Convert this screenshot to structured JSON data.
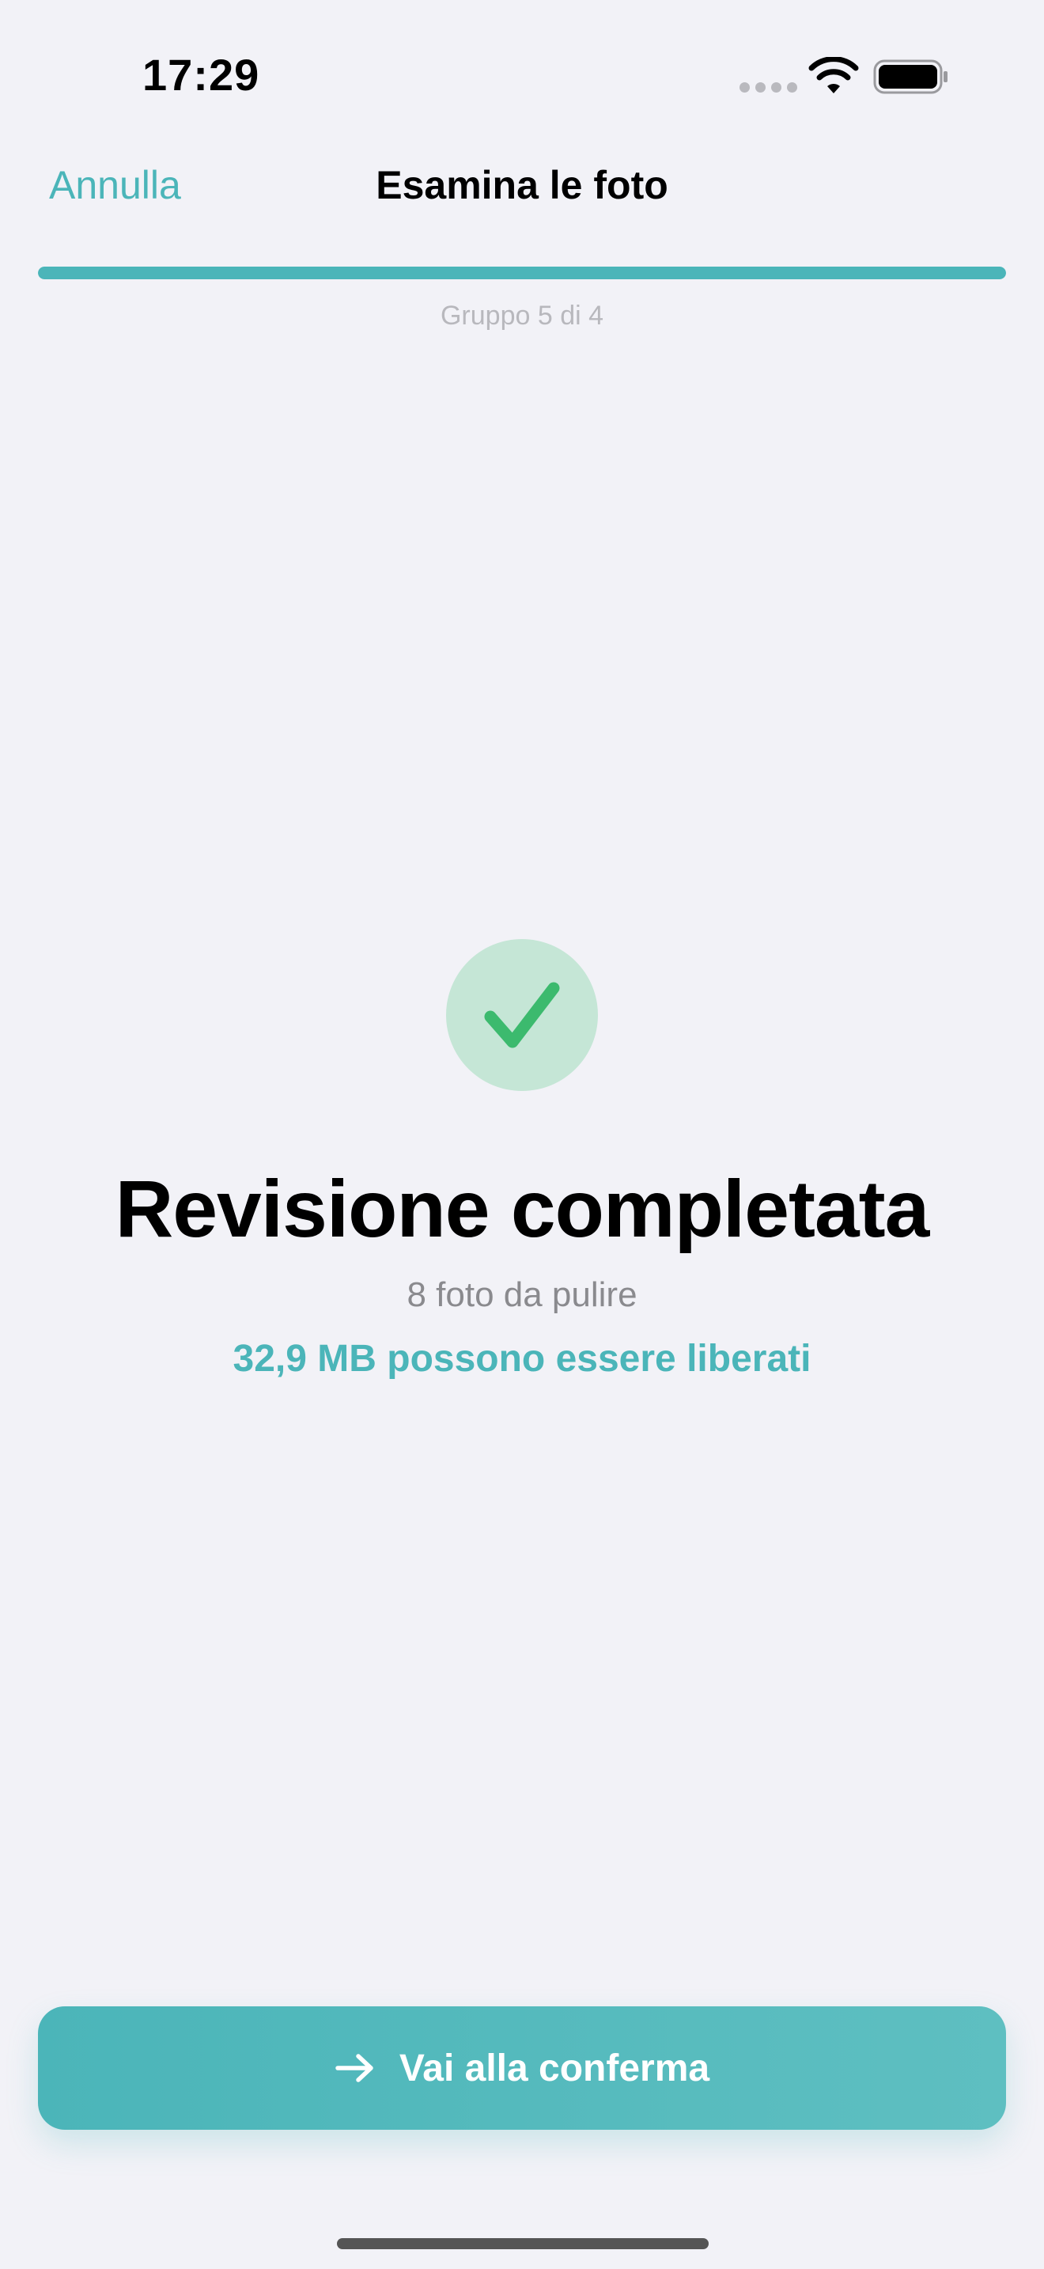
{
  "status_bar": {
    "time": "17:29",
    "icons": [
      "signal-dots-icon",
      "wifi-icon",
      "battery-icon"
    ]
  },
  "nav": {
    "cancel_label": "Annulla",
    "title": "Esamina le foto"
  },
  "progress": {
    "fraction": 1.0,
    "label": "Gruppo 5 di 4"
  },
  "completion": {
    "icon": "checkmark-icon",
    "title": "Revisione completata",
    "subtitle": "8 foto da pulire",
    "freed_text": "32,9 MB possono essere liberati"
  },
  "action": {
    "icon": "arrow-right-icon",
    "label": "Vai alla conferma"
  },
  "colors": {
    "accent": "#4bb5b9",
    "success": "#3cba6e",
    "success_bg": "#c5e6d6",
    "background": "#f2f2f7"
  }
}
